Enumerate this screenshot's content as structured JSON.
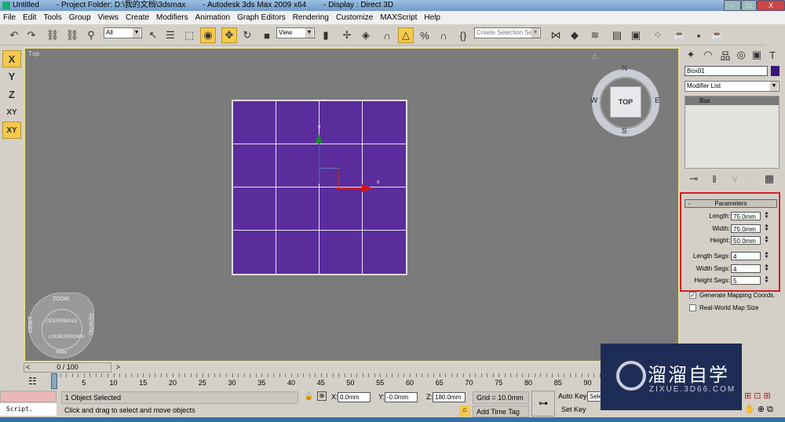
{
  "title": {
    "doc": "Untitled",
    "project": "- Project Folder: D:\\我的文档\\3dsmax",
    "app": "- Autodesk 3ds Max  2009 x64",
    "display": "- Display : Direct 3D",
    "min": "–",
    "max": "□",
    "close": "X"
  },
  "menu": [
    "File",
    "Edit",
    "Tools",
    "Group",
    "Views",
    "Create",
    "Modifiers",
    "Animation",
    "Graph Editors",
    "Rendering",
    "Customize",
    "MAXScript",
    "Help"
  ],
  "toolbar": {
    "filter": "All",
    "ref_coord": "View",
    "selection_set_placeholder": "Create Selection Set",
    "active_tool": "select-and-move"
  },
  "axis_constraints": [
    "X",
    "Y",
    "Z",
    "XY",
    "XY"
  ],
  "viewport": {
    "label": "Top",
    "viewcube": {
      "face": "TOP",
      "n": "N",
      "s": "S",
      "e": "E",
      "w": "W"
    },
    "object_color": "#5b2d9c",
    "gizmo_x": "x",
    "gizmo_y": "y",
    "steering_wheel": {
      "zoom": "ZOOM",
      "pan": "PAN",
      "orbit": "ORBIT",
      "rewind": "REWIND",
      "center": "CENTER",
      "walk": "WALK",
      "look": "LOOK",
      "updown": "UP/DOWN"
    }
  },
  "command_panel": {
    "object_name": "Box01",
    "object_color": "#3b1580",
    "modifier_list": "Modifier List",
    "stack": [
      "Box"
    ],
    "rollout": "Parameters",
    "rollout_toggle": "-",
    "params": [
      {
        "label": "Length:",
        "value": "75.0mm"
      },
      {
        "label": "Width:",
        "value": "75.0mm"
      },
      {
        "label": "Height:",
        "value": "50.0mm"
      },
      {
        "label": "Length Segs:",
        "value": "4"
      },
      {
        "label": "Width Segs:",
        "value": "4"
      },
      {
        "label": "Height Segs:",
        "value": "5"
      }
    ],
    "gen_mapping": {
      "label": "Generate Mapping Coords.",
      "checked": true
    },
    "real_world": {
      "label": "Real-World Map Size",
      "checked": false
    }
  },
  "timeline": {
    "slider": "0 / 100",
    "prev": "<",
    "next": ">",
    "ticks": [
      "0",
      "5",
      "10",
      "15",
      "20",
      "25",
      "30",
      "35",
      "40",
      "45",
      "50",
      "55",
      "60",
      "65",
      "70",
      "75",
      "80",
      "85",
      "90"
    ]
  },
  "status": {
    "selected": "1 Object Selected",
    "prompt": "Click and drag to select and move objects",
    "script": "Script.",
    "x_label": "X:",
    "x": "0.0mm",
    "y_label": "Y:",
    "y": "-0.0mm",
    "z_label": "Z:",
    "z": "180.0mm",
    "grid": "Grid = 10.0mm",
    "time_tag": "Add Time Tag",
    "auto_key": "Auto Key",
    "set_key": "Set Key",
    "key_filter": "Sele"
  },
  "watermark": {
    "title": "溜溜自学",
    "url": "ZIXUE.3D66.COM"
  }
}
